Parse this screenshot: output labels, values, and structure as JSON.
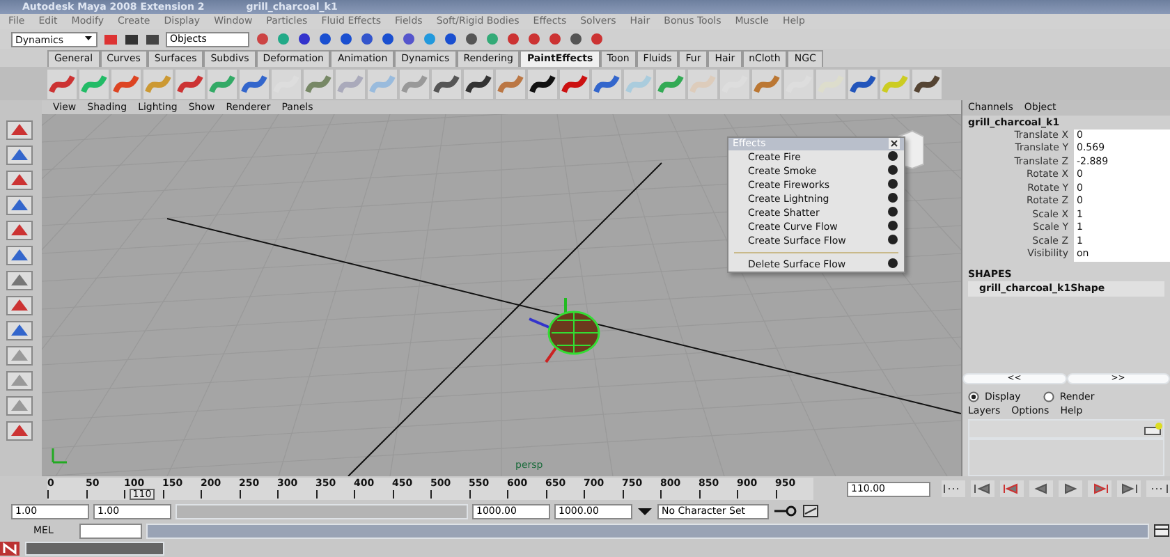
{
  "window": {
    "title": "Autodesk Maya 2008 Extension 2",
    "scene": "grill_charcoal_k1"
  },
  "menu": [
    "File",
    "Edit",
    "Modify",
    "Create",
    "Display",
    "Window",
    "Particles",
    "Fluid Effects",
    "Fields",
    "Soft/Rigid Bodies",
    "Effects",
    "Solvers",
    "Hair",
    "Bonus Tools",
    "Muscle",
    "Help"
  ],
  "status_line": {
    "menu_set": "Dynamics",
    "selection_field": "Objects"
  },
  "shelf_tabs": [
    {
      "label": "General",
      "selected": false
    },
    {
      "label": "Curves",
      "selected": false
    },
    {
      "label": "Surfaces",
      "selected": false
    },
    {
      "label": "Subdivs",
      "selected": false
    },
    {
      "label": "Deformation",
      "selected": false
    },
    {
      "label": "Animation",
      "selected": false
    },
    {
      "label": "Dynamics",
      "selected": false
    },
    {
      "label": "Rendering",
      "selected": false
    },
    {
      "label": "PaintEffects",
      "selected": true
    },
    {
      "label": "Toon",
      "selected": false
    },
    {
      "label": "Fluids",
      "selected": false
    },
    {
      "label": "Fur",
      "selected": false
    },
    {
      "label": "Hair",
      "selected": false
    },
    {
      "label": "nCloth",
      "selected": false
    },
    {
      "label": "NGC",
      "selected": false
    }
  ],
  "viewport": {
    "menu": [
      "View",
      "Shading",
      "Lighting",
      "Show",
      "Renderer",
      "Panels"
    ],
    "camera": "persp"
  },
  "effects_menu": {
    "title": "Effects",
    "items": [
      {
        "label": "Create Fire",
        "kind": "item"
      },
      {
        "label": "Create Smoke",
        "kind": "item"
      },
      {
        "label": "Create Fireworks",
        "kind": "item"
      },
      {
        "label": "Create Lightning",
        "kind": "item"
      },
      {
        "label": "Create Shatter",
        "kind": "item"
      },
      {
        "label": "Create Curve Flow",
        "kind": "item"
      },
      {
        "label": "Create Surface Flow",
        "kind": "item"
      },
      {
        "kind": "divider"
      },
      {
        "label": "Delete Surface Flow",
        "kind": "item"
      }
    ]
  },
  "channel_box": {
    "menu": [
      "Channels",
      "Object"
    ],
    "object": "grill_charcoal_k1",
    "attributes": [
      {
        "name": "Translate X",
        "value": "0"
      },
      {
        "name": "Translate Y",
        "value": "0.569"
      },
      {
        "name": "Translate Z",
        "value": "-2.889"
      },
      {
        "name": "Rotate X",
        "value": "0"
      },
      {
        "name": "Rotate Y",
        "value": "0"
      },
      {
        "name": "Rotate Z",
        "value": "0"
      },
      {
        "name": "Scale X",
        "value": "1"
      },
      {
        "name": "Scale Y",
        "value": "1"
      },
      {
        "name": "Scale Z",
        "value": "1"
      },
      {
        "name": "Visibility",
        "value": "on"
      }
    ],
    "shapes_heading": "SHAPES",
    "shape": "grill_charcoal_k1Shape"
  },
  "layer_editor": {
    "modes": [
      {
        "label": "Display",
        "selected": true
      },
      {
        "label": "Render",
        "selected": false
      }
    ],
    "menu": [
      "Layers",
      "Options",
      "Help"
    ],
    "scroll_buttons": [
      "<<",
      ">>"
    ]
  },
  "time_slider": {
    "ticks": [
      "0",
      "50",
      "100",
      "150",
      "200",
      "250",
      "300",
      "350",
      "400",
      "450",
      "500",
      "550",
      "600",
      "650",
      "700",
      "750",
      "800",
      "850",
      "900",
      "950"
    ],
    "current": "110",
    "level": 0.11,
    "current_time": "110.00"
  },
  "range_slider": {
    "level": 1,
    "start": "1.00",
    "range_start": "1.00",
    "range_end": "1000.00",
    "end": "1000.00",
    "character_set": "No Character Set"
  },
  "command_line": {
    "label": "MEL"
  }
}
